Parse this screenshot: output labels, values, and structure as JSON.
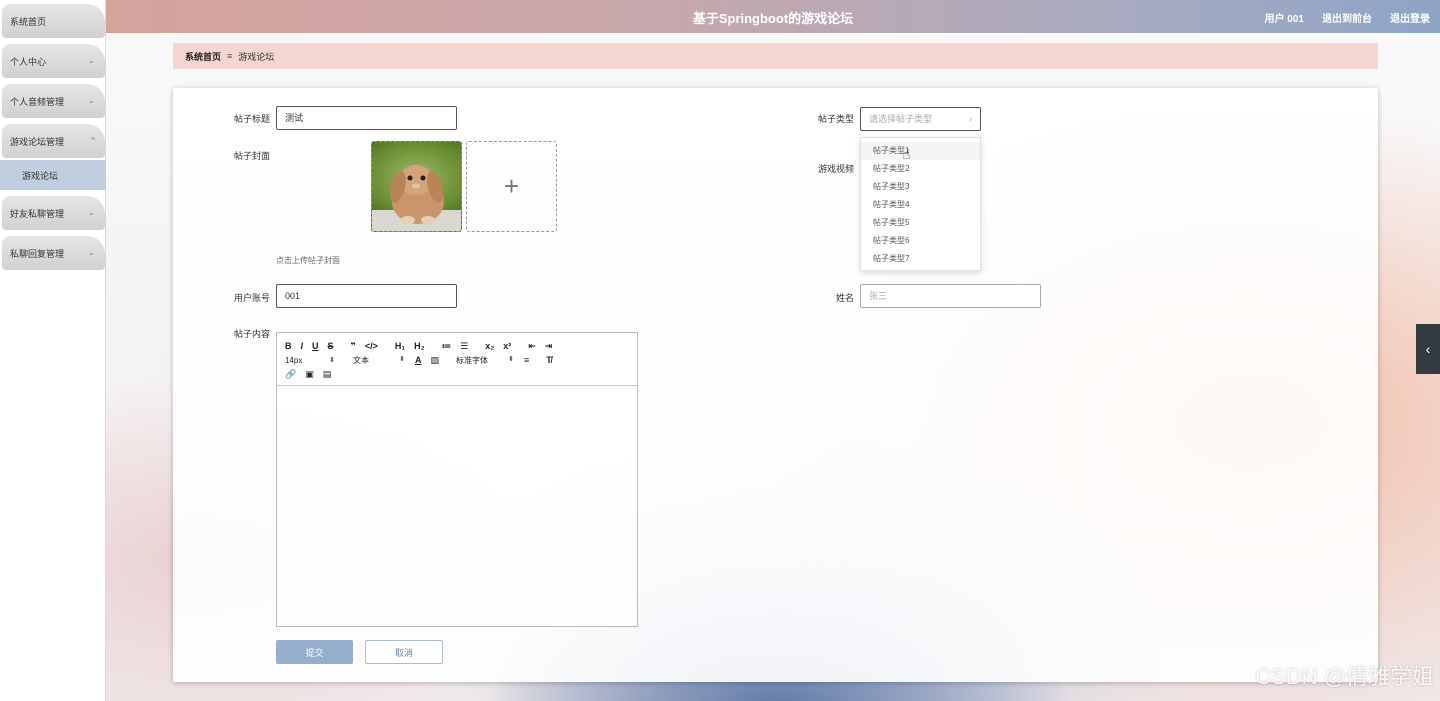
{
  "sidebar": {
    "items": [
      {
        "label": "系统首页",
        "expandable": false
      },
      {
        "label": "个人中心",
        "expandable": true
      },
      {
        "label": "个人音频管理",
        "expandable": true
      },
      {
        "label": "游戏论坛管理",
        "expandable": true,
        "expanded": true
      },
      {
        "label": "好友私聊管理",
        "expandable": true
      },
      {
        "label": "私聊回复管理",
        "expandable": true
      }
    ],
    "sub_item": "游戏论坛",
    "chevron_down": "⌄",
    "chevron_up": "^"
  },
  "header": {
    "title": "基于Springboot的游戏论坛",
    "user": "用户 001",
    "back_to_front": "退出到前台",
    "logout": "退出登录"
  },
  "breadcrumb": {
    "home": "系统首页",
    "separator": "≡",
    "current": "游戏论坛"
  },
  "form": {
    "title_label": "帖子标题",
    "title_value": "测试",
    "type_label": "帖子类型",
    "type_placeholder": "请选择帖子类型",
    "type_arrow": "›",
    "cover_label": "帖子封面",
    "cover_plus": "+",
    "cover_tip": "点击上传帖子封面",
    "video_label": "游戏视频",
    "account_label": "用户账号",
    "account_value": "001",
    "name_label": "姓名",
    "name_value": "张三",
    "content_label": "帖子内容",
    "type_options": [
      "帖子类型1",
      "帖子类型2",
      "帖子类型3",
      "帖子类型4",
      "帖子类型5",
      "帖子类型6",
      "帖子类型7"
    ],
    "submit": "提交",
    "cancel": "取消"
  },
  "editor": {
    "row1": [
      "B",
      "I",
      "U",
      "S",
      "❞",
      "</>",
      "H₁",
      "H₂",
      "≔",
      "☰",
      "x₂",
      "x²",
      "⇤",
      "⇥"
    ],
    "font_size": "14px",
    "block_type": "文本",
    "font_family": "标准字体",
    "select_arrow": "⬍",
    "align": "≡",
    "clear": "T̸",
    "color": "A",
    "bg": "▨",
    "row3": [
      "🔗",
      "▣",
      "▤"
    ]
  },
  "misc": {
    "side_toggle": "‹",
    "watermark": "CSDN @倩雅学姐",
    "pointer": "☝"
  }
}
